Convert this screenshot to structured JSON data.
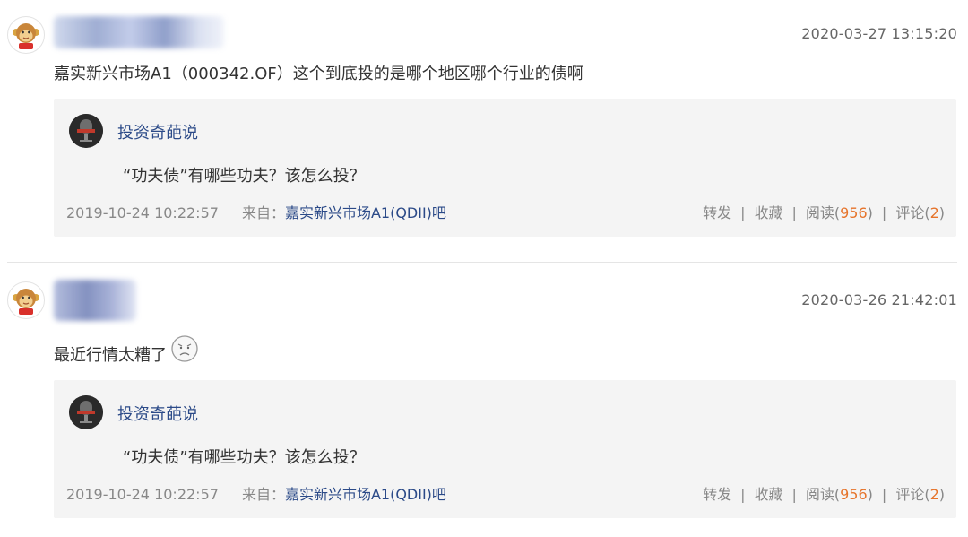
{
  "posts": [
    {
      "timestamp": "2020-03-27 13:15:20",
      "text": "嘉实新兴市场A1（000342.OF）这个到底投的是哪个地区哪个行业的债啊",
      "share": {
        "author": "投资奇葩说",
        "title": "“功夫债”有哪些功夫？该怎么投？",
        "date": "2019-10-24 10:22:57",
        "source_prefix": "来自：",
        "source_link": "嘉实新兴市场A1(QDII)吧",
        "repost": "转发",
        "favorite": "收藏",
        "read_label": "阅读(",
        "read_count": "956",
        "comment_label": "评论(",
        "comment_count": "2",
        "close_paren": ")",
        "sep": "|"
      }
    },
    {
      "timestamp": "2020-03-26 21:42:01",
      "text": "最近行情太糟了",
      "emoji": "frown-face",
      "share": {
        "author": "投资奇葩说",
        "title": "“功夫债”有哪些功夫？该怎么投？",
        "date": "2019-10-24 10:22:57",
        "source_prefix": "来自：",
        "source_link": "嘉实新兴市场A1(QDII)吧",
        "repost": "转发",
        "favorite": "收藏",
        "read_label": "阅读(",
        "read_count": "956",
        "comment_label": "评论(",
        "comment_count": "2",
        "close_paren": ")",
        "sep": "|"
      }
    }
  ],
  "colors": {
    "link": "#2b4a88",
    "count": "#e6742b",
    "meta": "#888888",
    "card_bg": "#f4f4f4"
  }
}
